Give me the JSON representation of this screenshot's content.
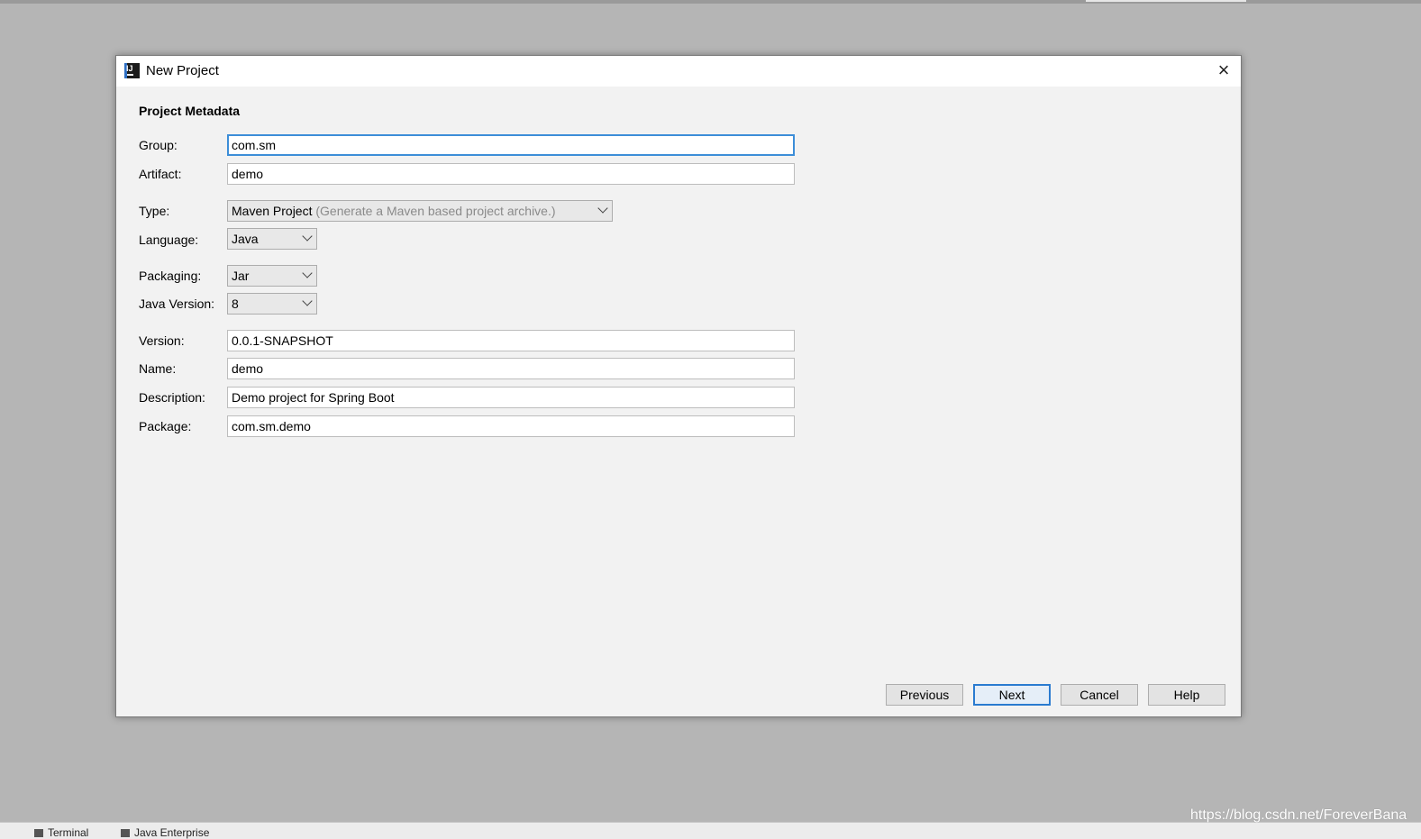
{
  "dialog": {
    "title": "New Project",
    "close_symbol": "×",
    "icon": "intellij-idea-icon",
    "icon_text": "IJ"
  },
  "metadata": {
    "section_title": "Project Metadata",
    "group": {
      "label": "Group:",
      "value": "com.sm"
    },
    "artifact": {
      "label": "Artifact:",
      "value": "demo"
    },
    "type": {
      "label": "Type:",
      "value": "Maven Project",
      "hint": "(Generate a Maven based project archive.)"
    },
    "language": {
      "label": "Language:",
      "value": "Java"
    },
    "packaging": {
      "label": "Packaging:",
      "value": "Jar"
    },
    "java_version": {
      "label": "Java Version:",
      "value": "8"
    },
    "version": {
      "label": "Version:",
      "value": "0.0.1-SNAPSHOT"
    },
    "name": {
      "label": "Name:",
      "value": "demo"
    },
    "description": {
      "label": "Description:",
      "value": "Demo project for Spring Boot"
    },
    "package": {
      "label": "Package:",
      "value": "com.sm.demo"
    }
  },
  "buttons": {
    "previous": "Previous",
    "next": "Next",
    "cancel": "Cancel",
    "help": "Help"
  },
  "bottom_bar": {
    "terminal": "Terminal",
    "java_enterprise": "Java Enterprise"
  },
  "watermark": "https://blog.csdn.net/ForeverBana",
  "colors": {
    "focus_border": "#3d8ed8",
    "primary_button_border": "#2a7bd0",
    "backdrop": "#b5b5b5"
  }
}
